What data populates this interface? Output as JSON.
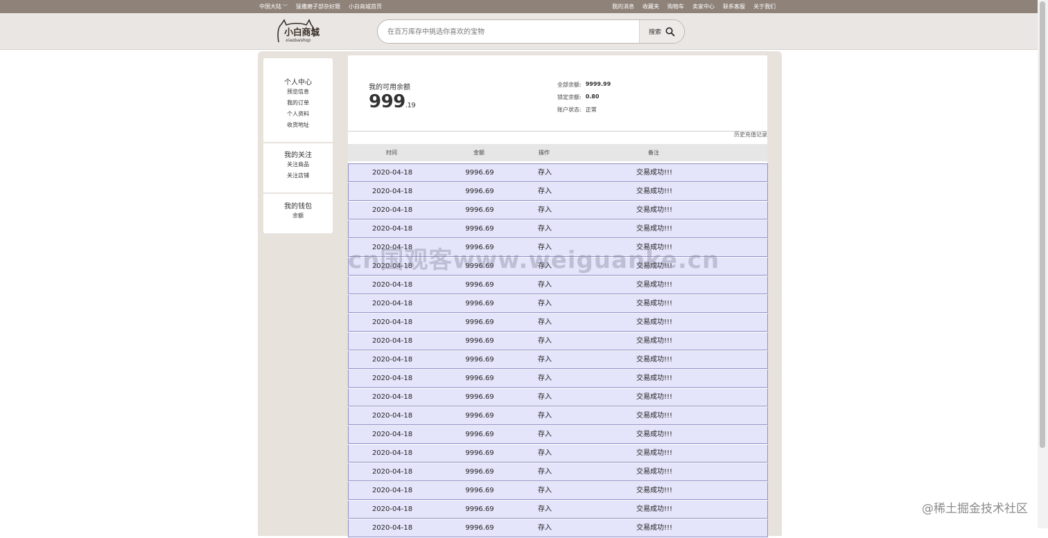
{
  "topbar": {
    "left": [
      "中国大陆",
      "猛撒磨子部杂好题",
      "小白商城首页"
    ],
    "right": [
      "我的消息",
      "收藏夹",
      "购物车",
      "卖家中心",
      "联系客服",
      "关于我们"
    ]
  },
  "header": {
    "logo_text": "小白商城",
    "logo_sub": "xiaobaishop",
    "search_placeholder": "在百万库存中挑选你喜欢的宝物",
    "search_button": "搜索"
  },
  "sidebar": {
    "groups": [
      {
        "title": "个人中心",
        "items": [
          "预览信息",
          "我的订单",
          "个人资料",
          "收货地址"
        ]
      },
      {
        "title": "我的关注",
        "items": [
          "关注商品",
          "关注店铺"
        ]
      },
      {
        "title": "我的钱包",
        "items": [
          "余额"
        ]
      }
    ]
  },
  "balance": {
    "label": "我的可用余额",
    "integer": "999",
    "decimal": ".19",
    "total_label": "全部余额:",
    "total_value": "9999.99",
    "locked_label": "锁定余额:",
    "locked_value": "0.80",
    "status_label": "账户状态:",
    "status_value": "正常",
    "history_link": "历史充值记录"
  },
  "table": {
    "headers": [
      "时间",
      "金额",
      "操作",
      "备注"
    ],
    "rows": [
      [
        "2020-04-18",
        "9996.69",
        "存入",
        "交易成功!!!"
      ],
      [
        "2020-04-18",
        "9996.69",
        "存入",
        "交易成功!!!"
      ],
      [
        "2020-04-18",
        "9996.69",
        "存入",
        "交易成功!!!"
      ],
      [
        "2020-04-18",
        "9996.69",
        "存入",
        "交易成功!!!"
      ],
      [
        "2020-04-18",
        "9996.69",
        "存入",
        "交易成功!!!"
      ],
      [
        "2020-04-18",
        "9996.69",
        "存入",
        "交易成功!!!"
      ],
      [
        "2020-04-18",
        "9996.69",
        "存入",
        "交易成功!!!"
      ],
      [
        "2020-04-18",
        "9996.69",
        "存入",
        "交易成功!!!"
      ],
      [
        "2020-04-18",
        "9996.69",
        "存入",
        "交易成功!!!"
      ],
      [
        "2020-04-18",
        "9996.69",
        "存入",
        "交易成功!!!"
      ],
      [
        "2020-04-18",
        "9996.69",
        "存入",
        "交易成功!!!"
      ],
      [
        "2020-04-18",
        "9996.69",
        "存入",
        "交易成功!!!"
      ],
      [
        "2020-04-18",
        "9996.69",
        "存入",
        "交易成功!!!"
      ],
      [
        "2020-04-18",
        "9996.69",
        "存入",
        "交易成功!!!"
      ],
      [
        "2020-04-18",
        "9996.69",
        "存入",
        "交易成功!!!"
      ],
      [
        "2020-04-18",
        "9996.69",
        "存入",
        "交易成功!!!"
      ],
      [
        "2020-04-18",
        "9996.69",
        "存入",
        "交易成功!!!"
      ],
      [
        "2020-04-18",
        "9996.69",
        "存入",
        "交易成功!!!"
      ],
      [
        "2020-04-18",
        "9996.69",
        "存入",
        "交易成功!!!"
      ],
      [
        "2020-04-18",
        "9996.69",
        "存入",
        "交易成功!!!"
      ]
    ]
  },
  "watermark": "cn国观客www.weiguanke.cn",
  "corner_watermark": "@稀土掘金技术社区",
  "colors": {
    "topbar": "#8f8279",
    "header_bg": "#eae6e3",
    "frame_bg": "#e8e2dd",
    "row_bg": "#e4e4fa",
    "row_border": "#8e8ec4"
  }
}
